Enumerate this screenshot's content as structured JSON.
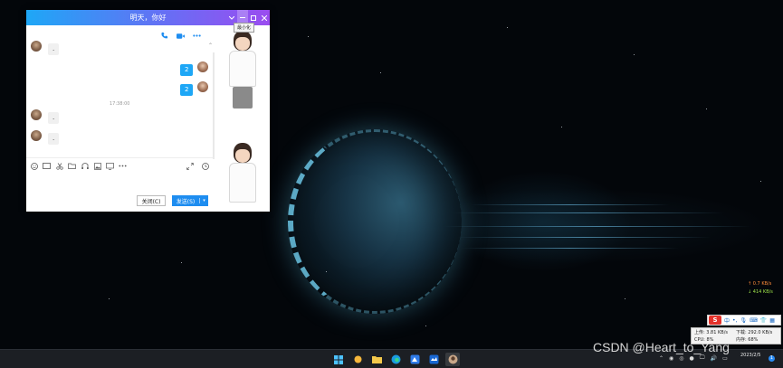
{
  "chat": {
    "title": "明天，你好",
    "tooltip": "最小化",
    "messages": [
      {
        "side": "them",
        "text": "."
      },
      {
        "side": "me",
        "text": "2"
      },
      {
        "side": "me",
        "text": "2"
      },
      {
        "side": "them",
        "text": "."
      },
      {
        "side": "them",
        "text": "."
      }
    ],
    "timestamp": "17:38:00",
    "close_label": "关闭(C)",
    "send_label": "发送(S)"
  },
  "net": {
    "up": "↑ 0.7 KB/s",
    "down": "↓ 414 KB/s"
  },
  "ime": {
    "logo": "S",
    "mode": "中"
  },
  "sysmon": {
    "upload": "上传: 3.81 KB/s",
    "download": "下载: 292.0 KB/s",
    "cpu": "CPU: 8%",
    "memory": "内存: 68%"
  },
  "taskbar": {
    "date": "2023/2/5",
    "notifications": "1"
  },
  "watermark": "CSDN @Heart_to_Yang",
  "colors": {
    "title_gradient_start": "#1ea7f6",
    "title_gradient_end": "#9b4cf0",
    "my_bubble": "#1ea7f6",
    "send_button": "#1e8df0",
    "ime_logo": "#e4322b",
    "net_up": "#ff8c3a",
    "net_down": "#9ee34a"
  },
  "icons": {
    "title": [
      "minimize-icon",
      "maximize-icon",
      "close-icon"
    ],
    "chat_top": [
      "phone-icon",
      "video-icon",
      "more-icon"
    ],
    "toolbar": [
      "emoji-icon",
      "image-icon",
      "scissors-icon",
      "folder-icon",
      "music-icon",
      "picture-icon",
      "screen-icon",
      "more-icon"
    ],
    "toolbar_right": [
      "expand-icon",
      "history-icon"
    ],
    "taskbar": [
      "windows-start-icon",
      "weather-icon",
      "file-explorer-icon",
      "edge-icon",
      "app-icon-1",
      "app-icon-2",
      "chat-app-icon"
    ]
  }
}
